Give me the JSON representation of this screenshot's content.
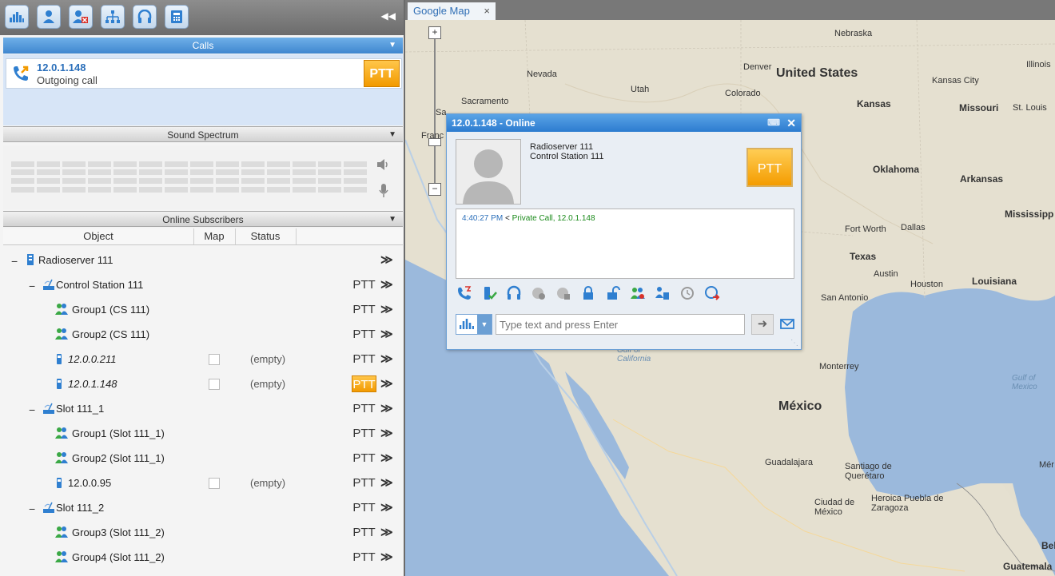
{
  "toolbar": {
    "buttons": [
      "dispatcher-icon",
      "subscriber-icon",
      "blocked-user-icon",
      "network-icon",
      "headset-icon",
      "journal-icon"
    ],
    "collapse_icon": "double-chevron-left"
  },
  "calls": {
    "title": "Calls",
    "item": {
      "ip": "12.0.1.148",
      "status": "Outgoing call",
      "ptt": "PTT"
    }
  },
  "spectrum": {
    "title": "Sound Spectrum"
  },
  "subscribers": {
    "title": "Online Subscribers",
    "columns": [
      "Object",
      "Map",
      "Status"
    ],
    "rows": [
      {
        "label": "Radioserver 111",
        "ptt": "",
        "empty": "",
        "more": "≫"
      },
      {
        "label": "Control Station 111",
        "ptt": "PTT",
        "empty": "",
        "more": "≫"
      },
      {
        "label": "Group1 (CS 111)",
        "ptt": "PTT",
        "empty": "",
        "more": "≫"
      },
      {
        "label": "Group2 (CS 111)",
        "ptt": "PTT",
        "empty": "",
        "more": "≫"
      },
      {
        "label": "12.0.0.211",
        "ptt": "PTT",
        "empty": "(empty)",
        "more": "≫"
      },
      {
        "label": "12.0.1.148",
        "ptt": "PTT",
        "empty": "(empty)",
        "more": "≫"
      },
      {
        "label": "Slot 111_1",
        "ptt": "PTT",
        "empty": "",
        "more": "≫"
      },
      {
        "label": "Group1 (Slot 111_1)",
        "ptt": "PTT",
        "empty": "",
        "more": "≫"
      },
      {
        "label": "Group2 (Slot 111_1)",
        "ptt": "PTT",
        "empty": "",
        "more": "≫"
      },
      {
        "label": "12.0.0.95",
        "ptt": "PTT",
        "empty": "(empty)",
        "more": "≫"
      },
      {
        "label": "Slot 111_2",
        "ptt": "PTT",
        "empty": "",
        "more": "≫"
      },
      {
        "label": "Group3 (Slot 111_2)",
        "ptt": "PTT",
        "empty": "",
        "more": "≫"
      },
      {
        "label": "Group4 (Slot 111_2)",
        "ptt": "PTT",
        "empty": "",
        "more": "≫"
      }
    ]
  },
  "map_tab": {
    "label": "Google Map",
    "close": "×"
  },
  "map": {
    "labels": {
      "nebraska": "Nebraska",
      "illinois": "Illinois",
      "nevada": "Nevada",
      "denver": "Denver",
      "united_states": "United States",
      "kansas_city": "Kansas City",
      "utah": "Utah",
      "sacramento": "Sacramento",
      "colorado": "Colorado",
      "kansas": "Kansas",
      "missouri": "Missouri",
      "st_louis": "St. Louis",
      "oklahoma": "Oklahoma",
      "arkansas": "Arkansas",
      "mississippi": "Mississipp",
      "fort_worth": "Fort Worth",
      "dallas": "Dallas",
      "texas": "Texas",
      "austin": "Austin",
      "houston": "Houston",
      "louisiana": "Louisiana",
      "san_antonio": "San Antonio",
      "gulf_california": "Gulf of California",
      "monterrey": "Monterrey",
      "gulf_mexico": "Gulf of Mexico",
      "mexico": "México",
      "guadalajara": "Guadalajara",
      "santiago": "Santiago de Querétaro",
      "merida": "Mér",
      "ciudad": "Ciudad de México",
      "puebla": "Heroica Puebla de Zaragoza",
      "belize": "Beli",
      "guatemala": "Guatemala",
      "fran": "Franc",
      "sa": "Sa"
    },
    "zoom_in": "+",
    "zoom_out": "−"
  },
  "popup": {
    "title": "12.0.1.148 - Online",
    "radioserver": "Radioserver  111",
    "control_station": "Control Station  111",
    "ptt": "PTT",
    "log": {
      "time": "4:40:27 PM",
      "arrow": "<",
      "text": "Private Call, 12.0.1.148"
    },
    "message_placeholder": "Type text and press Enter"
  },
  "colors": {
    "accent_blue": "#3f86cf",
    "ptt_orange": "#f29a00",
    "link_blue": "#2b6fba",
    "log_green": "#1a8a1a"
  }
}
